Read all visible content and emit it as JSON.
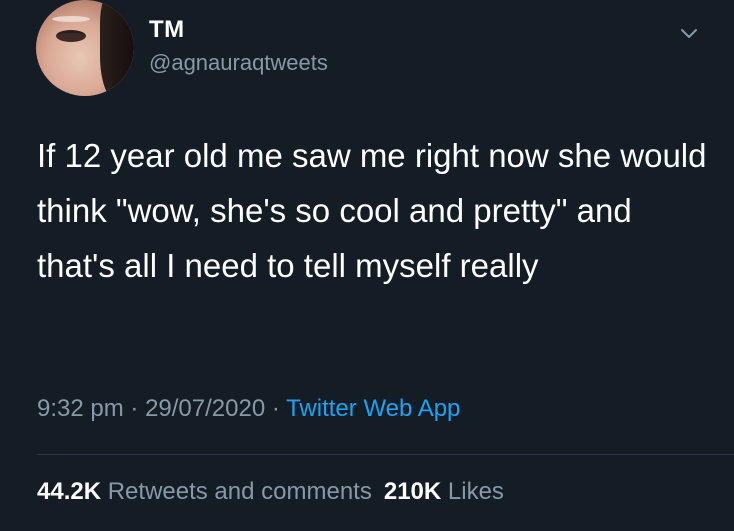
{
  "user": {
    "name": "TM",
    "handle": "@agnauraqtweets"
  },
  "tweet": {
    "text": "If 12 year old me saw me right now she would think \"wow, she's so cool and pretty\" and that's all I need to tell myself really",
    "time": "9:32 pm",
    "date": "29/07/2020",
    "separator": "·",
    "source": "Twitter Web App"
  },
  "stats": {
    "retweets_count": "44.2K",
    "retweets_label": "Retweets and comments",
    "likes_count": "210K",
    "likes_label": "Likes"
  },
  "icons": {
    "menu": "chevron-down-icon"
  },
  "colors": {
    "background": "#141c26",
    "muted": "#8899a6",
    "link": "#1da1f2"
  }
}
